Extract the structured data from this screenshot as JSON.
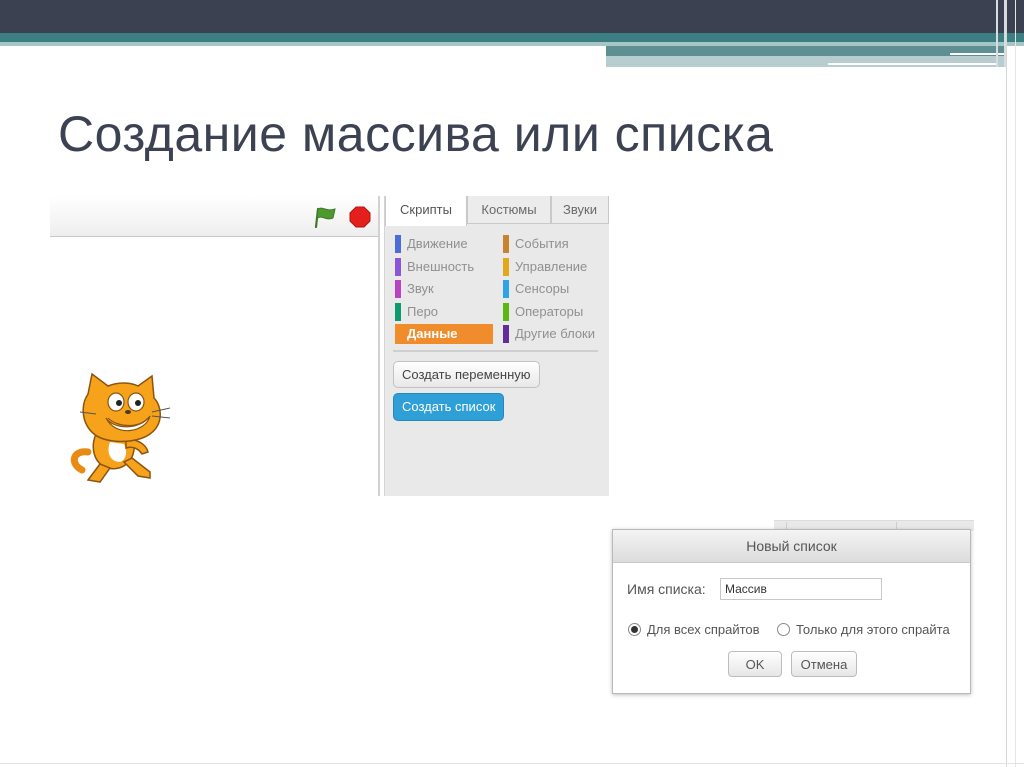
{
  "slide": {
    "title": "Создание массива или списка"
  },
  "palette": {
    "tabs": [
      "Скрипты",
      "Костюмы",
      "Звуки"
    ],
    "active_tab": "Скрипты",
    "categories": [
      {
        "label": "Движение",
        "color": "#4a6cd4"
      },
      {
        "label": "Внешность",
        "color": "#8a55d7"
      },
      {
        "label": "Звук",
        "color": "#bb42c3"
      },
      {
        "label": "Перо",
        "color": "#0e9a6c"
      },
      {
        "label": "Данные",
        "color": "#ee7d16"
      },
      {
        "label": "События",
        "color": "#c88330"
      },
      {
        "label": "Управление",
        "color": "#e1a91a"
      },
      {
        "label": "Сенсоры",
        "color": "#2ca5e2"
      },
      {
        "label": "Операторы",
        "color": "#5cb712"
      },
      {
        "label": "Другие блоки",
        "color": "#632d99"
      }
    ],
    "selected_category": "Данные",
    "make_variable_label": "Создать переменную",
    "make_list_label": "Создать список"
  },
  "stage": {
    "sprite": "scratch-cat",
    "green_flag_icon": "green-flag-icon",
    "stop_icon": "stop-icon"
  },
  "dialog": {
    "title": "Новый список",
    "name_label": "Имя списка:",
    "name_value": "Массив",
    "radio_all": "Для всех спрайтов",
    "radio_this": "Только для этого спрайта",
    "radio_selected": "Для всех спрайтов",
    "ok_label": "OK",
    "cancel_label": "Отмена"
  },
  "colors": {
    "title_text": "#3d4253",
    "top_bar": "#3c4151",
    "accent_teal": "#3c7f83",
    "data_category": "#f08c2b",
    "make_list_button": "#2f9fd8"
  }
}
